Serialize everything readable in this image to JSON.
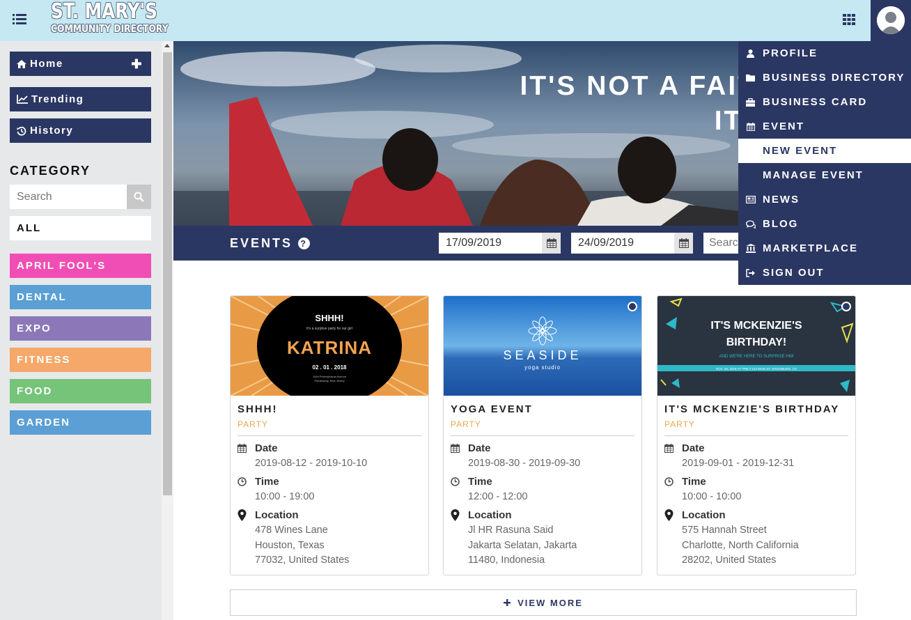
{
  "header": {
    "logo_line1": "ST. MARY'S",
    "logo_line2": "COMMUNITY DIRECTORY"
  },
  "sidebar": {
    "nav": [
      {
        "label": "Home",
        "icon": "home-icon"
      },
      {
        "label": "Trending",
        "icon": "chart-line-icon"
      },
      {
        "label": "History",
        "icon": "history-icon"
      }
    ],
    "category_title": "CATEGORY",
    "search_placeholder": "Search",
    "all_label": "ALL",
    "categories": [
      {
        "label": "APRIL FOOL'S",
        "color": "#f04eb4"
      },
      {
        "label": "DENTAL",
        "color": "#5b9fd4"
      },
      {
        "label": "EXPO",
        "color": "#8c78b8"
      },
      {
        "label": "FITNESS",
        "color": "#f5a86a"
      },
      {
        "label": "FOOD",
        "color": "#76c47a"
      },
      {
        "label": "GARDEN",
        "color": "#5b9fd4"
      }
    ]
  },
  "hero": {
    "line1": "IT'S NOT A FAITH IN TECH",
    "line2": "IT'S FAITH IN"
  },
  "events_bar": {
    "title": "EVENTS",
    "date_from": "17/09/2019",
    "date_to": "24/09/2019",
    "search_placeholder": "Searc"
  },
  "cards": [
    {
      "title": "SHHH!",
      "category": "PARTY",
      "date_label": "Date",
      "date": "2019-08-12 - 2019-10-10",
      "time_label": "Time",
      "time": "10:00 - 19:00",
      "location_label": "Location",
      "loc1": "478 Wines Lane",
      "loc2": "Houston, Texas",
      "loc3": "77032, United States",
      "image": {
        "big": "KATRINA",
        "top": "SHHH!",
        "sub": "It's a surprise party for our girl",
        "date": "02 . 01 . 2018",
        "addr1": "1549 Pennsylvania Avenue",
        "addr2": "Piscataway, New Jersey"
      }
    },
    {
      "title": "YOGA EVENT",
      "category": "PARTY",
      "date_label": "Date",
      "date": "2019-08-30 - 2019-09-30",
      "time_label": "Time",
      "time": "12:00 - 12:00",
      "location_label": "Location",
      "loc1": "Jl HR Rasuna Said",
      "loc2": "Jakarta Selatan, Jakarta",
      "loc3": "11480, Indonesia",
      "image": {
        "big": "SEASIDE",
        "sub": "yoga studio"
      }
    },
    {
      "title": "IT'S MCKENZIE'S BIRTHDAY",
      "category": "PARTY",
      "date_label": "Date",
      "date": "2019-09-01 - 2019-12-31",
      "time_label": "Time",
      "time": "10:00 - 10:00",
      "location_label": "Location",
      "loc1": "575 Hannah Street",
      "loc2": "Charlotte, North California",
      "loc3": "28202, United States",
      "image": {
        "line1": "IT'S MCKENZIE'S",
        "line2": "BIRTHDAY!",
        "sub": "AND WE'RE HERE TO SURPRISE HIM",
        "band": "NOV. 29, 2018 AT 7PM // 123 MAIN ST. KINGSBURG, CA"
      }
    }
  ],
  "view_more": "VIEW MORE",
  "dropdown": [
    {
      "label": "PROFILE",
      "icon": "user-icon"
    },
    {
      "label": "BUSINESS DIRECTORY",
      "icon": "folder-icon"
    },
    {
      "label": "BUSINESS CARD",
      "icon": "briefcase-icon"
    },
    {
      "label": "EVENT",
      "icon": "calendar-icon"
    },
    {
      "label": "NEW EVENT",
      "icon": ""
    },
    {
      "label": "MANAGE EVENT",
      "icon": ""
    },
    {
      "label": "NEWS",
      "icon": "newspaper-icon"
    },
    {
      "label": "BLOG",
      "icon": "comments-icon"
    },
    {
      "label": "MARKETPLACE",
      "icon": "bank-icon"
    },
    {
      "label": "SIGN OUT",
      "icon": "sign-out-icon"
    }
  ],
  "colors": {
    "navy": "#2b3763",
    "topbar": "#c5e8f3",
    "party": "#e8a84a"
  }
}
